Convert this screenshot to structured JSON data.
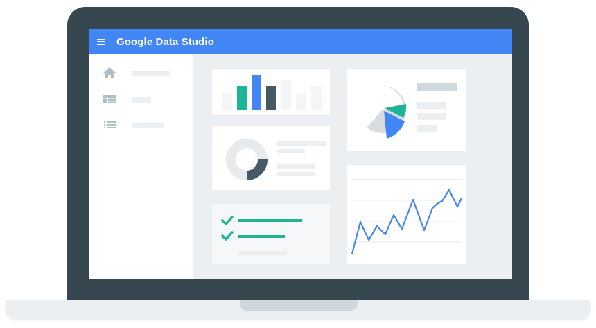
{
  "app": {
    "title": "Google Data Studio"
  },
  "sidebar": {
    "items": [
      {
        "icon": "home-icon"
      },
      {
        "icon": "table-icon"
      },
      {
        "icon": "list-icon"
      }
    ]
  },
  "colors": {
    "header": "#4285f4",
    "teal": "#1db497",
    "blue": "#4285f4",
    "dark": "#455a64",
    "light": "#eceff1",
    "grey": "#cfd8dc"
  },
  "cards": {
    "bar_chart": {
      "type": "bar",
      "bar_heights_relative": [
        0.5,
        0.8,
        1.0,
        0.8,
        0.9,
        0.5,
        0.8
      ]
    },
    "pie_chart": {
      "type": "pie",
      "slices": [
        "grey",
        "teal",
        "blue"
      ]
    },
    "donut_chart": {
      "type": "donut",
      "segments": [
        "light",
        "dark"
      ]
    },
    "checklist": {
      "items_checked": 2
    },
    "line_chart": {
      "type": "line",
      "values": [
        0.1,
        0.45,
        0.22,
        0.42,
        0.3,
        0.55,
        0.4,
        0.7,
        0.35,
        0.62,
        0.7,
        0.68,
        0.95,
        0.75,
        0.82
      ]
    }
  }
}
